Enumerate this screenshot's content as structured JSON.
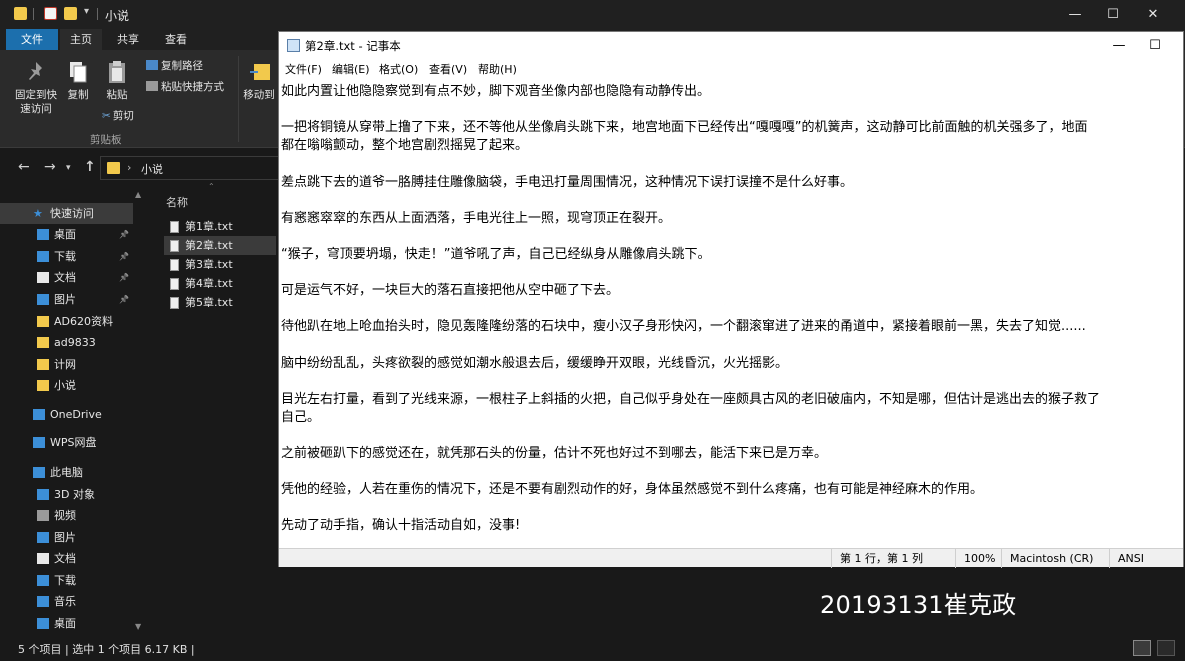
{
  "explorer": {
    "title": "小说",
    "window_controls": {
      "minimize": "—",
      "maximize": "☐",
      "close": "✕"
    },
    "ribbon_tabs": [
      "文件",
      "主页",
      "共享",
      "查看"
    ],
    "ribbon": {
      "pin_label_1": "固定到快",
      "pin_label_2": "速访问",
      "copy_label": "复制",
      "paste_label": "粘贴",
      "copy_path": "复制路径",
      "paste_shortcut": "粘贴快捷方式",
      "cut": "剪切",
      "move_to": "移动到",
      "group_clipboard": "剪贴板"
    },
    "address": {
      "chevron": "›",
      "path": "小说"
    },
    "column_name": "名称",
    "nav_items": [
      {
        "label": "快速访问",
        "icon": "star-icon",
        "pinned": false
      },
      {
        "label": "桌面",
        "icon": "desktop-icon",
        "pinned": true
      },
      {
        "label": "下载",
        "icon": "download-icon",
        "pinned": true
      },
      {
        "label": "文档",
        "icon": "document-icon",
        "pinned": true
      },
      {
        "label": "图片",
        "icon": "picture-icon",
        "pinned": true
      },
      {
        "label": "AD620资料",
        "icon": "folder-icon",
        "pinned": false
      },
      {
        "label": "ad9833",
        "icon": "folder-icon",
        "pinned": false
      },
      {
        "label": "计网",
        "icon": "folder-icon",
        "pinned": false
      },
      {
        "label": "小说",
        "icon": "folder-icon",
        "pinned": false
      },
      {
        "label": "OneDrive",
        "icon": "cloud-icon",
        "pinned": false
      },
      {
        "label": "WPS网盘",
        "icon": "cloud-icon",
        "pinned": false
      },
      {
        "label": "此电脑",
        "icon": "computer-icon",
        "pinned": false
      },
      {
        "label": "3D 对象",
        "icon": "cube-icon",
        "pinned": false
      },
      {
        "label": "视频",
        "icon": "video-icon",
        "pinned": false
      },
      {
        "label": "图片",
        "icon": "picture-icon",
        "pinned": false
      },
      {
        "label": "文档",
        "icon": "document-icon",
        "pinned": false
      },
      {
        "label": "下载",
        "icon": "download-icon",
        "pinned": false
      },
      {
        "label": "音乐",
        "icon": "music-icon",
        "pinned": false
      },
      {
        "label": "桌面",
        "icon": "desktop-icon",
        "pinned": false
      }
    ],
    "files": [
      "第1章.txt",
      "第2章.txt",
      "第3章.txt",
      "第4章.txt",
      "第5章.txt"
    ],
    "selected_file": "第2章.txt",
    "status": "5 个项目  |  选中 1 个项目  6.17 KB  |"
  },
  "notepad": {
    "title": "第2章.txt - 记事本",
    "window_controls": {
      "minimize": "—",
      "maximize": "☐"
    },
    "menu": [
      "文件(F)",
      "编辑(E)",
      "格式(O)",
      "查看(V)",
      "帮助(H)"
    ],
    "lines": [
      "如此内置让他隐隐察觉到有点不妙，脚下观音坐像内部也隐隐有动静传出。",
      "",
      "一把将铜镜从穿带上撸了下来，还不等他从坐像肩头跳下来，地宫地面下已经传出“嘎嘎嘎”的机簧声，这动静可比前面触的机关强多了，地面",
      "都在嗡嗡颤动，整个地宫剧烈摇晃了起来。",
      "",
      "差点跳下去的道爷一胳膊挂住雕像脑袋，手电迅打量周围情况，这种情况下误打误撞不是什么好事。",
      "",
      "有窸窸窣窣的东西从上面洒落，手电光往上一照，现穹顶正在裂开。",
      "",
      "“猴子，穹顶要坍塌，快走！”道爷吼了声，自己已经纵身从雕像肩头跳下。",
      "",
      "可是运气不好，一块巨大的落石直接把他从空中砸了下去。",
      "",
      "待他趴在地上呛血抬头时，隐见轰隆隆纷落的石块中，瘦小汉子身形快闪，一个翻滚窜进了进来的甬道中，紧接着眼前一黑，失去了知觉......",
      "",
      "脑中纷纷乱乱，头疼欲裂的感觉如潮水般退去后，缓缓睁开双眼，光线昏沉，火光摇影。",
      "",
      "目光左右打量，看到了光线来源，一根柱子上斜插的火把，自己似乎身处在一座颇具古风的老旧破庙内，不知是哪，但估计是逃出去的猴子救了",
      "自己。",
      "",
      "之前被砸趴下的感觉还在，就凭那石头的份量，估计不死也好过不到哪去，能活下来已是万幸。",
      "",
      "凭他的经验，人若在重伤的情况下，还是不要有剧烈动作的好，身体虽然感觉不到什么疼痛，也有可能是神经麻木的作用。",
      "",
      "先动了动手指，确认十指活动自如，没事!"
    ],
    "status": {
      "position": "第 1 行，第 1 列",
      "zoom": "100%",
      "line_ending": "Macintosh (CR)",
      "encoding": "ANSI"
    }
  },
  "watermark": "20193131崔克政",
  "colors": {
    "explorer_bg": "#191919",
    "file_tab_accent": "#1c6fad",
    "folder_yellow": "#f2c94c",
    "selection": "#3b3b3b",
    "notepad_bg": "#ffffff"
  }
}
